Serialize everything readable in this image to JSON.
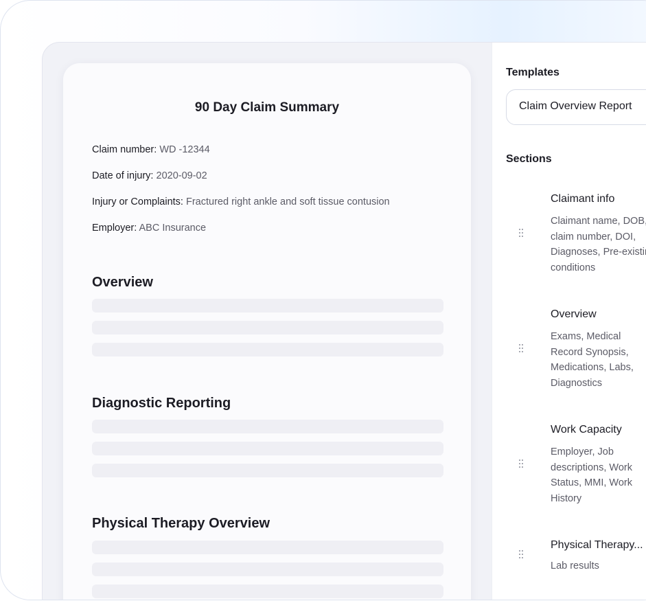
{
  "document": {
    "title": "90 Day Claim Summary",
    "claim_number": {
      "label": "Claim number:",
      "value": "WD -12344"
    },
    "date_of_injury": {
      "label": "Date of injury:",
      "value": "2020-09-02"
    },
    "injury": {
      "label": "Injury or Complaints:",
      "value": "Fractured right ankle and soft tissue contusion"
    },
    "employer": {
      "label": "Employer:",
      "value": "ABC Insurance"
    },
    "sections": [
      "Overview",
      "Diagnostic Reporting",
      "Physical Therapy Overview"
    ]
  },
  "panel": {
    "templates_label": "Templates",
    "selected_template": "Claim Overview Report",
    "sections_label": "Sections",
    "items": [
      {
        "title": "Claimant info",
        "description": "Claimant name, DOB,\nclaim number, DOI,\nDiagnoses, Pre-existing\nconditions"
      },
      {
        "title": "Overview",
        "description": "Exams, Medical\nRecord Synopsis,\nMedications, Labs,\nDiagnostics"
      },
      {
        "title": "Work Capacity",
        "description": "Employer, Job\ndescriptions, Work\nStatus, MMI, Work\nHistory"
      },
      {
        "title": "Physical Therapy...",
        "description": " Lab results"
      }
    ]
  }
}
